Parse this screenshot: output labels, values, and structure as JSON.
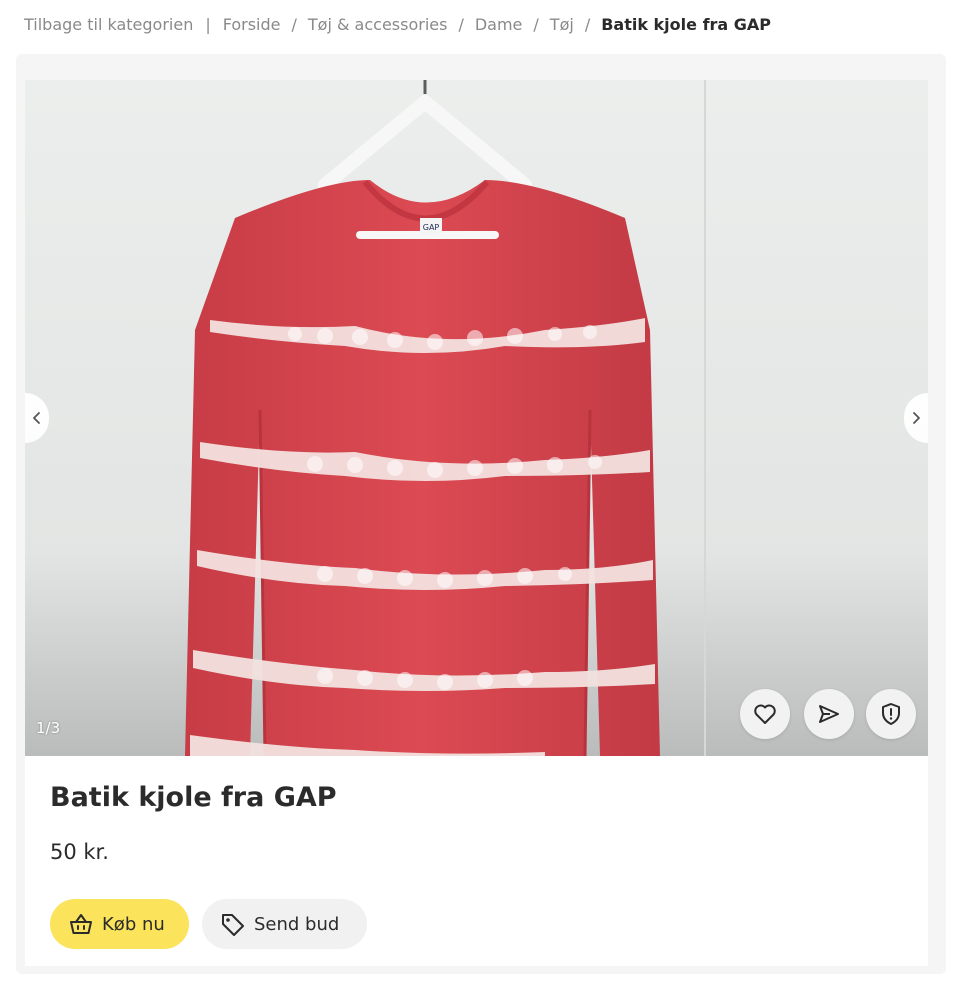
{
  "breadcrumb": {
    "back_label": "Tilbage til kategorien",
    "items": [
      "Forside",
      "Tøj & accessories",
      "Dame",
      "Tøj"
    ],
    "current": "Batik kjole fra GAP"
  },
  "gallery": {
    "counter": "1/3",
    "label_on_tag": "GAP"
  },
  "icons": {
    "prev": "chevron-left-icon",
    "next": "chevron-right-icon",
    "favorite": "heart-icon",
    "share": "send-icon",
    "report": "shield-alert-icon",
    "buy": "basket-icon",
    "bid": "tag-icon"
  },
  "listing": {
    "title": "Batik kjole fra GAP",
    "price": "50 kr."
  },
  "actions": {
    "buy_label": "Køb nu",
    "bid_label": "Send bud"
  },
  "colors": {
    "buy_button": "#fbe35c",
    "bid_button": "#f1f1f1",
    "garment_red": "#d9474f"
  }
}
